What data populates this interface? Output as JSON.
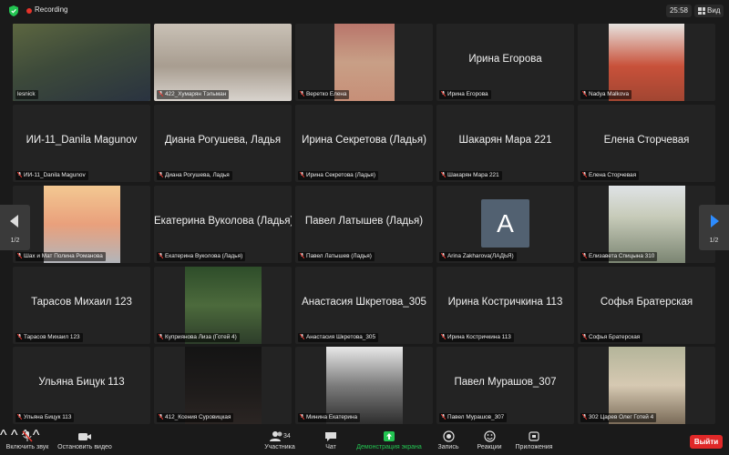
{
  "topbar": {
    "recording_label": "Recording",
    "timer": "25:58",
    "view_label": "Вид"
  },
  "nav": {
    "left_page": "1/2",
    "right_page": "1/2"
  },
  "tiles": [
    {
      "name": "",
      "foot": "lesnick",
      "muted": false,
      "video": true,
      "active": true
    },
    {
      "name": "",
      "foot": "422_Хумарян Тэльман",
      "muted": true,
      "video": true
    },
    {
      "name": "",
      "foot": "Веретко Елена",
      "muted": true,
      "video": true
    },
    {
      "name": "Ирина Егорова",
      "foot": "Ирина Егорова",
      "muted": true
    },
    {
      "name": "",
      "foot": "Nadya Malkova",
      "muted": true,
      "video": true
    },
    {
      "name": "ИИ-11_Danila Magunov",
      "foot": "ИИ-11_Danila Magunov",
      "muted": true
    },
    {
      "name": "Диана Рогушева, Ладья",
      "foot": "Диана Рогушева, Ладья",
      "muted": true
    },
    {
      "name": "Ирина Секретова (Ладья)",
      "foot": "Ирина Секретова (Ладья)",
      "muted": true
    },
    {
      "name": "Шакарян Мара 221",
      "foot": "Шакарян Мара 221",
      "muted": true
    },
    {
      "name": "Елена Сторчевая",
      "foot": "Елена Сторчевая",
      "muted": true
    },
    {
      "name": "",
      "foot": "Шах и Мат Полина Романова",
      "muted": true,
      "video": true
    },
    {
      "name": "Екатерина Вуколова (Ладья)",
      "foot": "Екатерина Вуколова (Ладья)",
      "muted": true
    },
    {
      "name": "Павел Латышев (Ладья)",
      "foot": "Павел Латышев (Ладья)",
      "muted": true
    },
    {
      "name": "",
      "foot": "Arina Zakharova(ЛАДЬЯ)",
      "muted": true,
      "avatar": "A"
    },
    {
      "name": "",
      "foot": "Елизавета Спицына 310",
      "muted": true,
      "video": true
    },
    {
      "name": "Тарасов Михаил 123",
      "foot": "Тарасов Михаил 123",
      "muted": true
    },
    {
      "name": "",
      "foot": "Куприянова Лиза (Готей 4)",
      "muted": true,
      "video": true
    },
    {
      "name": "Анастасия Шкретова_305",
      "foot": "Анастасия Шкретова_305",
      "muted": true
    },
    {
      "name": "Ирина Костричкина 113",
      "foot": "Ирина Костричкина 113",
      "muted": true
    },
    {
      "name": "Софья Братерская",
      "foot": "Софья Братерская",
      "muted": true
    },
    {
      "name": "Ульяна Бицук 113",
      "foot": "Ульяна Бицук 113",
      "muted": true
    },
    {
      "name": "",
      "foot": "412_Ксения Суровицкая",
      "muted": true,
      "video": true
    },
    {
      "name": "",
      "foot": "Минина Екатерина",
      "muted": true,
      "video": true
    },
    {
      "name": "Павел Мурашов_307",
      "foot": "Павел Мурашов_307",
      "muted": true
    },
    {
      "name": "",
      "foot": "302 Царев Олег Готей 4",
      "muted": true,
      "video": true
    }
  ],
  "toolbar": {
    "unmute": "Включить звук",
    "start_video": "Остановить видео",
    "participants": "Участника",
    "participants_count": "34",
    "chat": "Чат",
    "share_screen": "Демонстрация экрана",
    "record": "Запись",
    "reactions": "Реакции",
    "apps": "Приложения",
    "leave": "Выйти"
  },
  "colors": {
    "active_speaker": "#c6e05c",
    "share_green": "#23c552",
    "leave_red": "#e02828",
    "nav_arrow_blue": "#2d8cff"
  }
}
